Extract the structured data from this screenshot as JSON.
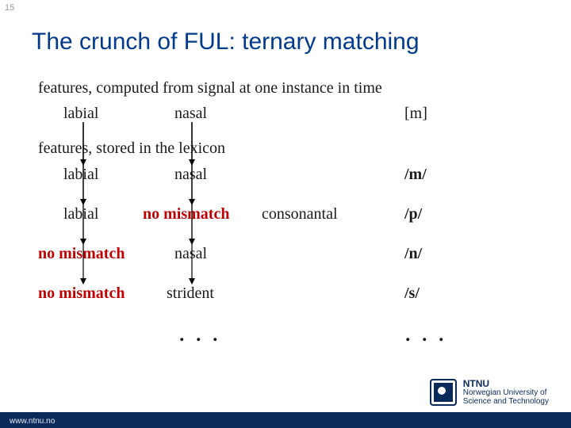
{
  "page_number": "15",
  "title": "The crunch of FUL: ternary matching",
  "line1": "features, computed from signal at one instance in time",
  "row_signal": {
    "c1": "labial",
    "c2": "nasal",
    "c3": "[m]"
  },
  "line2": "features, stored in the lexicon",
  "rows": [
    {
      "c1": "labial",
      "c2": "nasal",
      "c2b": "",
      "c3": "/m/"
    },
    {
      "c1": "labial",
      "c2": "no mismatch",
      "c2b": "consonantal",
      "c3": "/p/"
    },
    {
      "c1": "no mismatch",
      "c2": "nasal",
      "c2b": "",
      "c3": "/n/"
    },
    {
      "c1": "no mismatch",
      "c2": "strident",
      "c2b": "",
      "c3": "/s/"
    }
  ],
  "ellipsis": ". . .",
  "footer_url": "www.ntnu.no",
  "logo": {
    "acronym": "NTNU",
    "line2": "Norwegian University of",
    "line3": "Science and Technology"
  }
}
